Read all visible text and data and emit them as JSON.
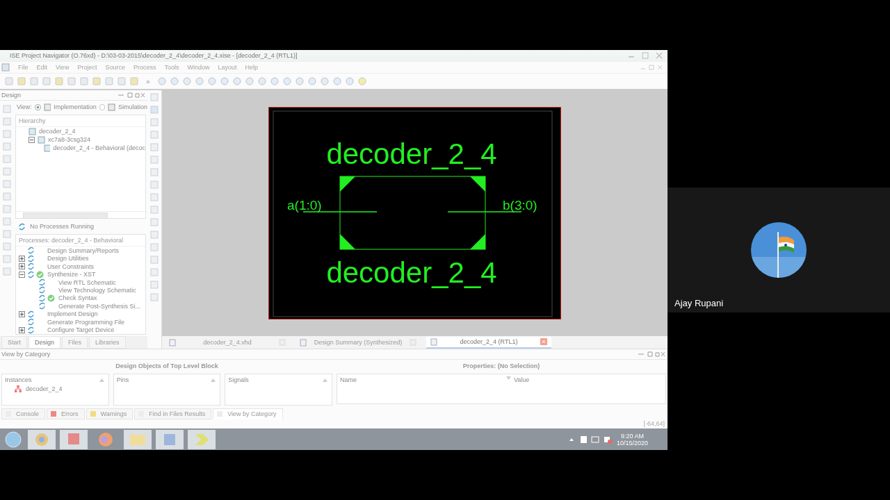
{
  "window": {
    "title": "ISE Project Navigator (O.76xd) - D:\\03-03-2015\\decoder_2_4\\decoder_2_4.xise - [decoder_2_4 (RTL1)]"
  },
  "menu": [
    "File",
    "Edit",
    "View",
    "Project",
    "Source",
    "Process",
    "Tools",
    "Window",
    "Layout",
    "Help"
  ],
  "toolbar": {
    "overflow": "»"
  },
  "design_panel": {
    "title": "Design",
    "view_label": "View:",
    "views": [
      {
        "label": "Implementation",
        "selected": true
      },
      {
        "label": "Simulation",
        "selected": false
      }
    ],
    "hierarchy_title": "Hierarchy",
    "hierarchy": [
      {
        "label": "decoder_2_4"
      },
      {
        "label": "xc7a8-3csg324",
        "expanded": true,
        "children": [
          {
            "label": "decoder_2_4 - Behavioral (decoc"
          }
        ]
      }
    ],
    "process_status": "No Processes Running",
    "processes_title": "Processes: decoder_2_4 - Behavioral",
    "processes": [
      {
        "label": "Design Summary/Reports",
        "checked": false
      },
      {
        "label": "Design Utilities",
        "checked": false,
        "expanded": false
      },
      {
        "label": "User Constraints",
        "checked": false,
        "expanded": false
      },
      {
        "label": "Synthesize - XST",
        "checked": true,
        "expanded": true,
        "children": [
          {
            "label": "View RTL Schematic",
            "checked": false
          },
          {
            "label": "View Technology Schematic",
            "checked": false
          },
          {
            "label": "Check Syntax",
            "checked": true
          },
          {
            "label": "Generate Post-Synthesis Si...",
            "checked": false
          }
        ]
      },
      {
        "label": "Implement Design",
        "checked": false,
        "expanded": false
      },
      {
        "label": "Generate Programming File",
        "checked": false
      },
      {
        "label": "Configure Target Device",
        "checked": false,
        "expanded": false
      }
    ],
    "tabs": [
      {
        "label": "Start",
        "selected": false
      },
      {
        "label": "Design",
        "selected": true
      },
      {
        "label": "Files",
        "selected": false
      },
      {
        "label": "Libraries",
        "selected": false
      }
    ]
  },
  "documents": [
    {
      "label": "decoder_2_4.vhd",
      "selected": false
    },
    {
      "label": "Design Summary (Synthesized)",
      "selected": false
    },
    {
      "label": "decoder_2_4 (RTL1)",
      "selected": true
    }
  ],
  "schematic": {
    "title": "decoder_2_4",
    "input": "a(1:0)",
    "output": "b(3:0)",
    "instance": "decoder_2_4"
  },
  "bottom_panel": {
    "title": "View by Category",
    "objects_title": "Design Objects of Top Level Block",
    "columns": [
      {
        "header": "Instances",
        "items": [
          "decoder_2_4"
        ]
      },
      {
        "header": "Pins"
      },
      {
        "header": "Signals"
      }
    ],
    "properties_title": "Properties: (No Selection)",
    "property_columns": [
      "Name",
      "Value"
    ],
    "tabs": [
      {
        "label": "Console",
        "selected": false
      },
      {
        "label": "Errors",
        "selected": false
      },
      {
        "label": "Warnings",
        "selected": false
      },
      {
        "label": "Find in Files Results",
        "selected": false
      },
      {
        "label": "View by Category",
        "selected": true
      }
    ],
    "coordinates": "[-64,64]"
  },
  "taskbar": {
    "time": "9:20 AM",
    "date": "10/15/2020"
  },
  "participant": {
    "name": "Ajay Rupani"
  }
}
